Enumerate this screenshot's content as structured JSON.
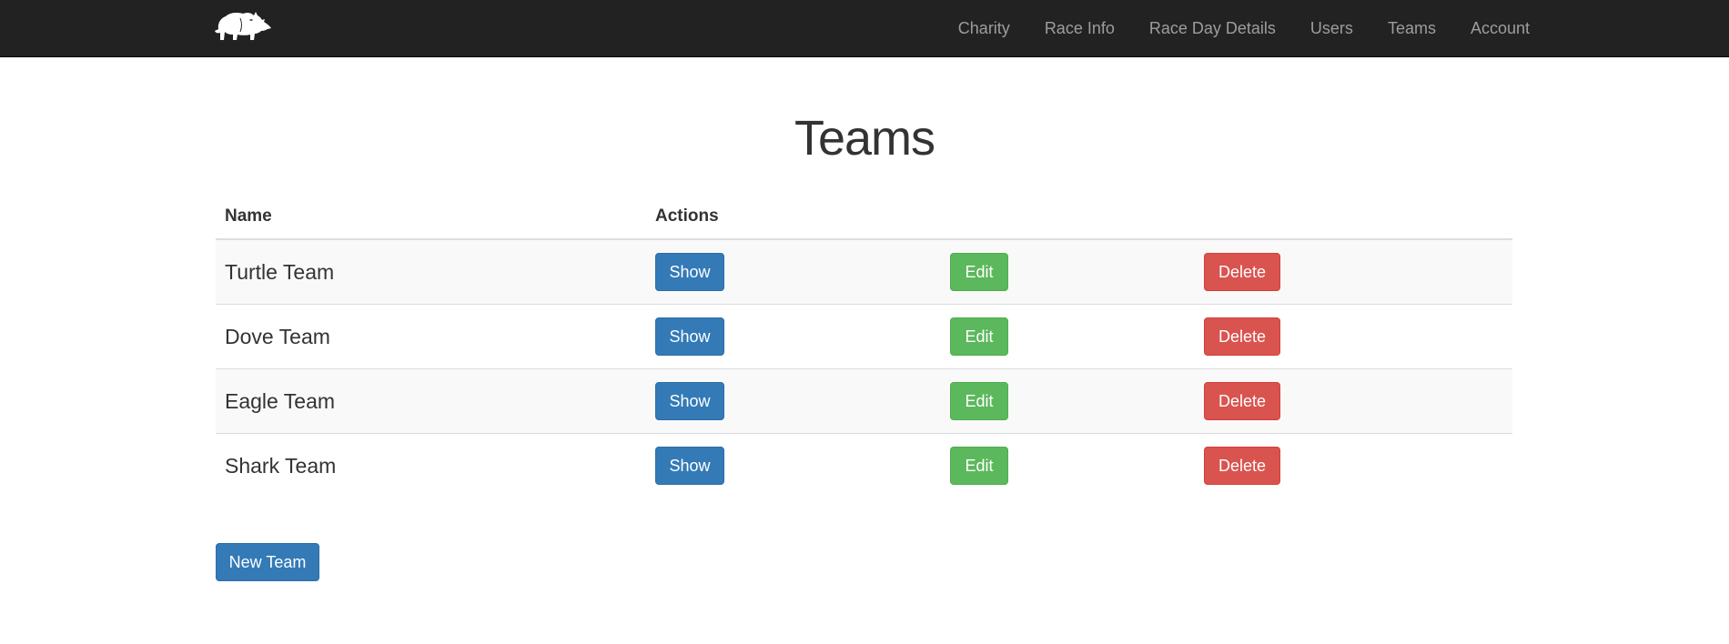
{
  "navbar": {
    "logo_icon": "rhino-logo-icon",
    "links": [
      "Charity",
      "Race Info",
      "Race Day Details",
      "Users",
      "Teams",
      "Account"
    ]
  },
  "page": {
    "title": "Teams"
  },
  "table": {
    "headers": [
      "Name",
      "Actions"
    ],
    "rows": [
      {
        "name": "Turtle Team"
      },
      {
        "name": "Dove Team"
      },
      {
        "name": "Eagle Team"
      },
      {
        "name": "Shark Team"
      }
    ],
    "show_label": "Show",
    "edit_label": "Edit",
    "delete_label": "Delete"
  },
  "actions": {
    "new_team_label": "New Team"
  },
  "colors": {
    "navbar_bg": "#222222",
    "nav_link": "#9d9d9d",
    "primary": "#337ab7",
    "success": "#5cb85c",
    "danger": "#d9534f",
    "striped_row": "#f9f9f9"
  }
}
